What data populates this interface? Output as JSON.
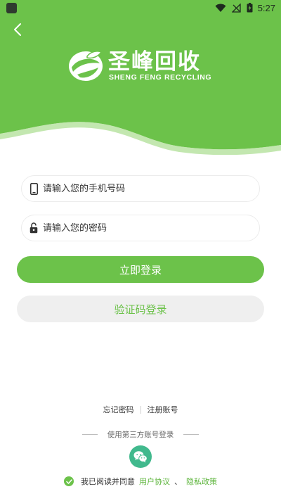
{
  "status_bar": {
    "time": "5:27"
  },
  "brand": {
    "name_cn": "圣峰回收",
    "name_en": "SHENG FENG RECYCLING",
    "primary_color": "#6cc24a",
    "wechat_color": "#41b98d"
  },
  "form": {
    "phone_placeholder": "请输入您的手机号码",
    "password_placeholder": "请输入您的密码",
    "login_label": "立即登录",
    "sms_login_label": "验证码登录"
  },
  "links": {
    "forgot_password": "忘记密码",
    "register": "注册账号"
  },
  "third_party": {
    "label": "使用第三方账号登录"
  },
  "agreement": {
    "prefix": "我已阅读并同意",
    "user_agreement": "用户协议",
    "separator": "、",
    "privacy_policy": "隐私政策",
    "checked": true
  }
}
